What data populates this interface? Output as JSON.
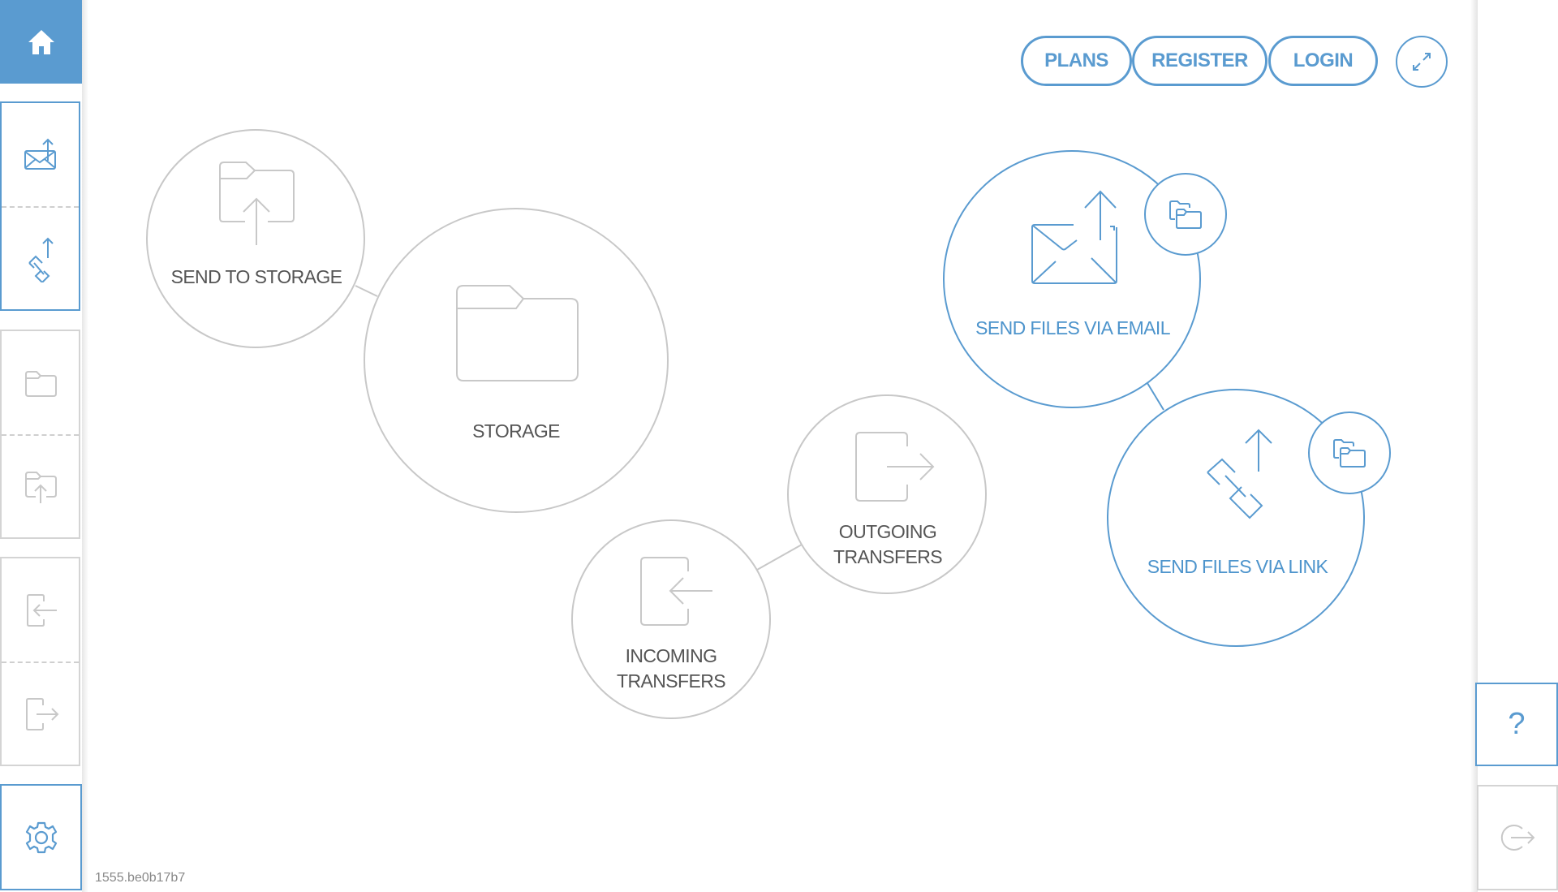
{
  "colors": {
    "accent": "#5a9bd0",
    "inactive_stroke": "#c8c8c8",
    "label_grey": "#555555"
  },
  "sidebar": {
    "home": {
      "icon": "home-icon"
    },
    "groups": [
      {
        "active": true,
        "items": [
          {
            "name": "send-via-email",
            "icon": "email-upload-icon"
          },
          {
            "name": "send-via-link",
            "icon": "link-upload-icon"
          }
        ]
      },
      {
        "active": false,
        "items": [
          {
            "name": "storage",
            "icon": "folder-icon"
          },
          {
            "name": "send-to-storage",
            "icon": "folder-upload-icon"
          }
        ]
      },
      {
        "active": false,
        "items": [
          {
            "name": "incoming-transfers",
            "icon": "incoming-icon"
          },
          {
            "name": "outgoing-transfers",
            "icon": "outgoing-icon"
          }
        ]
      }
    ],
    "settings": {
      "icon": "gear-icon"
    }
  },
  "header": {
    "plans_label": "PLANS",
    "register_label": "REGISTER",
    "login_label": "LOGIN",
    "expand_icon": "expand-icon"
  },
  "bubbles": {
    "send_to_storage": {
      "label": "SEND TO STORAGE"
    },
    "storage": {
      "label": "STORAGE"
    },
    "outgoing": {
      "label_line1": "OUTGOING",
      "label_line2": "TRANSFERS"
    },
    "incoming": {
      "label_line1": "INCOMING",
      "label_line2": "TRANSFERS"
    },
    "email": {
      "label": "SEND FILES VIA EMAIL"
    },
    "link": {
      "label": "SEND FILES VIA LINK"
    }
  },
  "right_bar": {
    "help_label": "?",
    "logout_icon": "logout-icon"
  },
  "footer": {
    "version": "1555.be0b17b7"
  }
}
